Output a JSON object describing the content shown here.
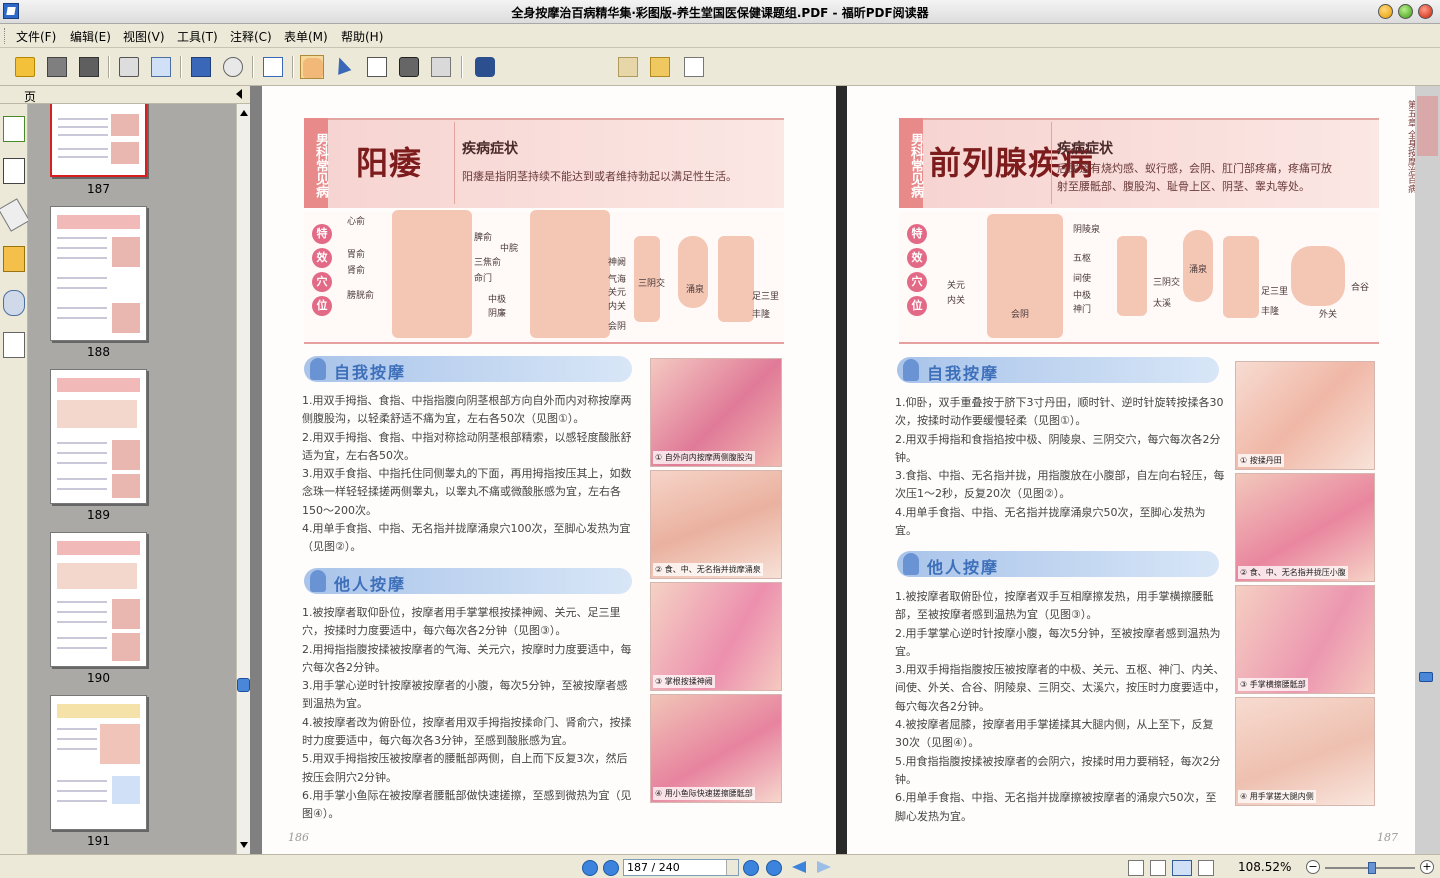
{
  "window": {
    "title": "全身按摩治百病精华集·彩图版-养生堂国医保健课题组.PDF - 福昕PDF阅读器"
  },
  "menu": [
    "文件(F)",
    "编辑(E)",
    "视图(V)",
    "工具(T)",
    "注释(C)",
    "表单(M)",
    "帮助(H)"
  ],
  "toolbar": {
    "search_value": "",
    "icons": [
      "open-folder-icon",
      "save-icon",
      "save-all-icon",
      "print-icon",
      "email-icon",
      "fullscreen-icon",
      "properties-icon",
      "page-icon",
      "hand-tool-icon",
      "select-tool-icon",
      "text-select-icon",
      "snapshot-icon",
      "typewriter-icon",
      "find-icon",
      "prev-result-icon",
      "next-result-icon",
      "export-icon"
    ]
  },
  "pane": {
    "label": "页",
    "thumbnails": [
      {
        "page": "187"
      },
      {
        "page": "188"
      },
      {
        "page": "189"
      },
      {
        "page": "190"
      },
      {
        "page": "191"
      }
    ]
  },
  "left_page": {
    "category": "男科常见病",
    "title": "阳痿",
    "symptom_label": "疾病症状",
    "symptom_text": "阳痿是指阴茎持续不能达到或者维持勃起以满足性生活。",
    "points_label": [
      "特",
      "效",
      "穴",
      "位"
    ],
    "points": [
      "心俞",
      "膀胱俞",
      "胃俞",
      "肾俞",
      "脾俞",
      "三焦俞",
      "命门",
      "中脘",
      "神阙",
      "气海",
      "关元",
      "中极",
      "阴廉",
      "内关",
      "会阴",
      "三阴交",
      "涌泉",
      "足三里",
      "丰隆"
    ],
    "self_title": "自我按摩",
    "self_items": [
      "1.用双手拇指、食指、中指指腹向阴茎根部方向自外而内对称按摩两侧腹股沟，以轻柔舒适不痛为宜，左右各50次（见图①）。",
      "2.用双手拇指、食指、中指对称捻动阴茎根部精索，以感轻度酸胀舒适为宜，左右各50次。",
      "3.用双手食指、中指托住同侧睾丸的下面，再用拇指按压其上，如数念珠一样轻轻揉搓两侧睾丸，以睾丸不痛或微酸胀感为宜，左右各150～200次。",
      "4.用单手食指、中指、无名指并拢摩涌泉穴100次，至脚心发热为宜（见图②）。"
    ],
    "other_title": "他人按摩",
    "other_items": [
      "1.被按摩者取仰卧位，按摩者用手掌掌根按揉神阙、关元、足三里穴，按揉时力度要适中，每穴每次各2分钟（见图③）。",
      "2.用拇指指腹按揉被按摩者的气海、关元穴，按摩时力度要适中，每穴每次各2分钟。",
      "3.用手掌心逆时针按摩被按摩者的小腹，每次5分钟，至被按摩者感到温热为宜。",
      "4.被按摩者改为俯卧位，按摩者用双手拇指按揉命门、肾俞穴，按揉时力度要适中，每穴每次各3分钟，至感到酸胀感为宜。",
      "5.用双手拇指按压被按摩者的腰骶部两侧，自上而下反复3次，然后按压会阴穴2分钟。",
      "6.用手掌小鱼际在被按摩者腰骶部做快速搓擦，至感到微热为宜（见图④）。"
    ],
    "captions": [
      "① 自外向内按摩两侧腹股沟",
      "② 食、中、无名指并拢摩涌泉",
      "③ 掌根按揉神阙",
      "④ 用小鱼际快速搓擦腰骶部"
    ],
    "page_number": "186"
  },
  "right_page": {
    "category": "男科常见病",
    "title": "前列腺疾病",
    "symptom_label": "疾病症状",
    "symptom_text": "后尿道有烧灼感、蚁行感，会阴、肛门部疼痛，疼痛可放射至腰骶部、腹股沟、耻骨上区、阴茎、睾丸等处。",
    "points_label": [
      "特",
      "效",
      "穴",
      "位"
    ],
    "points": [
      "阴陵泉",
      "五枢",
      "关元",
      "间使",
      "内关",
      "中极",
      "会阴",
      "神门",
      "三阴交",
      "太溪",
      "涌泉",
      "足三里",
      "丰隆",
      "合谷",
      "外关"
    ],
    "side_strip": "第五章 全身按摩治百病",
    "self_title": "自我按摩",
    "self_items": [
      "1.仰卧，双手重叠按于脐下3寸丹田，顺时针、逆时针旋转按揉各30次，按揉时动作要缓慢轻柔（见图①）。",
      "2.用双手拇指和食指掐按中极、阴陵泉、三阴交穴，每穴每次各2分钟。",
      "3.食指、中指、无名指并拢，用指腹放在小腹部，自左向右轻压，每次压1～2秒，反复20次（见图②）。",
      "4.用单手食指、中指、无名指并拢摩涌泉穴50次，至脚心发热为宜。"
    ],
    "other_title": "他人按摩",
    "other_items": [
      "1.被按摩者取俯卧位，按摩者双手互相摩擦发热，用手掌横擦腰骶部，至被按摩者感到温热为宜（见图③）。",
      "2.用手掌掌心逆时针按摩小腹，每次5分钟，至被按摩者感到温热为宜。",
      "3.用双手拇指指腹按压被按摩者的中极、关元、五枢、神门、内关、间使、外关、合谷、阴陵泉、三阴交、太溪穴，按压时力度要适中，每穴每次各2分钟。",
      "4.被按摩者屈膝，按摩者用手掌搓揉其大腿内侧，从上至下，反复30次（见图④）。",
      "5.用食指指腹按揉被按摩者的会阴穴，按揉时用力要稍轻，每次2分钟。",
      "6.用单手食指、中指、无名指并拢摩擦被按摩者的涌泉穴50次，至脚心发热为宜。"
    ],
    "captions": [
      "① 按揉丹田",
      "② 食、中、无名指并拢压小腹",
      "③ 手掌横擦腰骶部",
      "④ 用手掌搓大腿内侧"
    ],
    "page_number": "187"
  },
  "status": {
    "page_display": "187 / 240",
    "zoom": "108.52%"
  }
}
